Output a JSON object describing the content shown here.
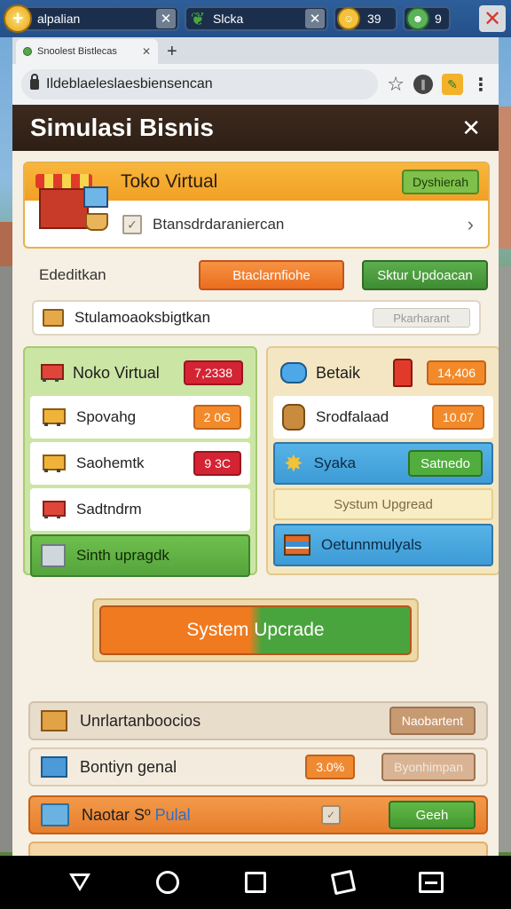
{
  "statusbar": {
    "coin_symbol": "+",
    "field1": "alpalian",
    "field2": "Slcka",
    "counter1": "39",
    "counter2": "9"
  },
  "browser": {
    "tab_title": "Snoolest Bistlecas",
    "url": "Ildeblaeleslaesbiensencan"
  },
  "panel": {
    "title": "Simulasi Bisnis",
    "store": {
      "name": "Toko Virtual",
      "button": "Dyshierah",
      "subtitle": "Btansdrdaraniercan"
    },
    "actions": {
      "label": "Ededitkan",
      "orange_button": "Btaclarnfiohe",
      "green_button": "Sktur Updoacan"
    },
    "search": {
      "label": "Stulamoaoksbigtkan",
      "placeholder": "Pkarharant"
    },
    "left_card": {
      "title": "Noko Virtual",
      "badge": "7,2338",
      "items": [
        {
          "label": "Spovahg",
          "badge": "2 0G"
        },
        {
          "label": "Saohemtk",
          "badge": "9 3C"
        },
        {
          "label": "Sadtndrm"
        },
        {
          "label": "Sinth upragdk"
        }
      ]
    },
    "right_card": {
      "title": "Betaik",
      "badge": "14,406",
      "items": [
        {
          "label": "Srodfalaad",
          "badge": "10.07"
        },
        {
          "label": "Syaka",
          "button": "Satnedo"
        },
        {
          "label": "Systum Upgread"
        },
        {
          "label": "Oetunnmulyals"
        }
      ]
    },
    "big_button": "System Upcrade",
    "list": [
      {
        "label": "Unrlartanboocios",
        "button": "Naobartent"
      },
      {
        "label": "Bontiyn genal",
        "badge": "3.0%",
        "button": "Byonhimpan"
      },
      {
        "label_main": "Naotar Sº",
        "label_blue": "Pulal",
        "button": "Geeh"
      }
    ]
  },
  "colors": {
    "header_brown": "#2e1f15",
    "orange": "#f07a20",
    "green": "#4aa43e",
    "red_badge": "#d42434"
  }
}
